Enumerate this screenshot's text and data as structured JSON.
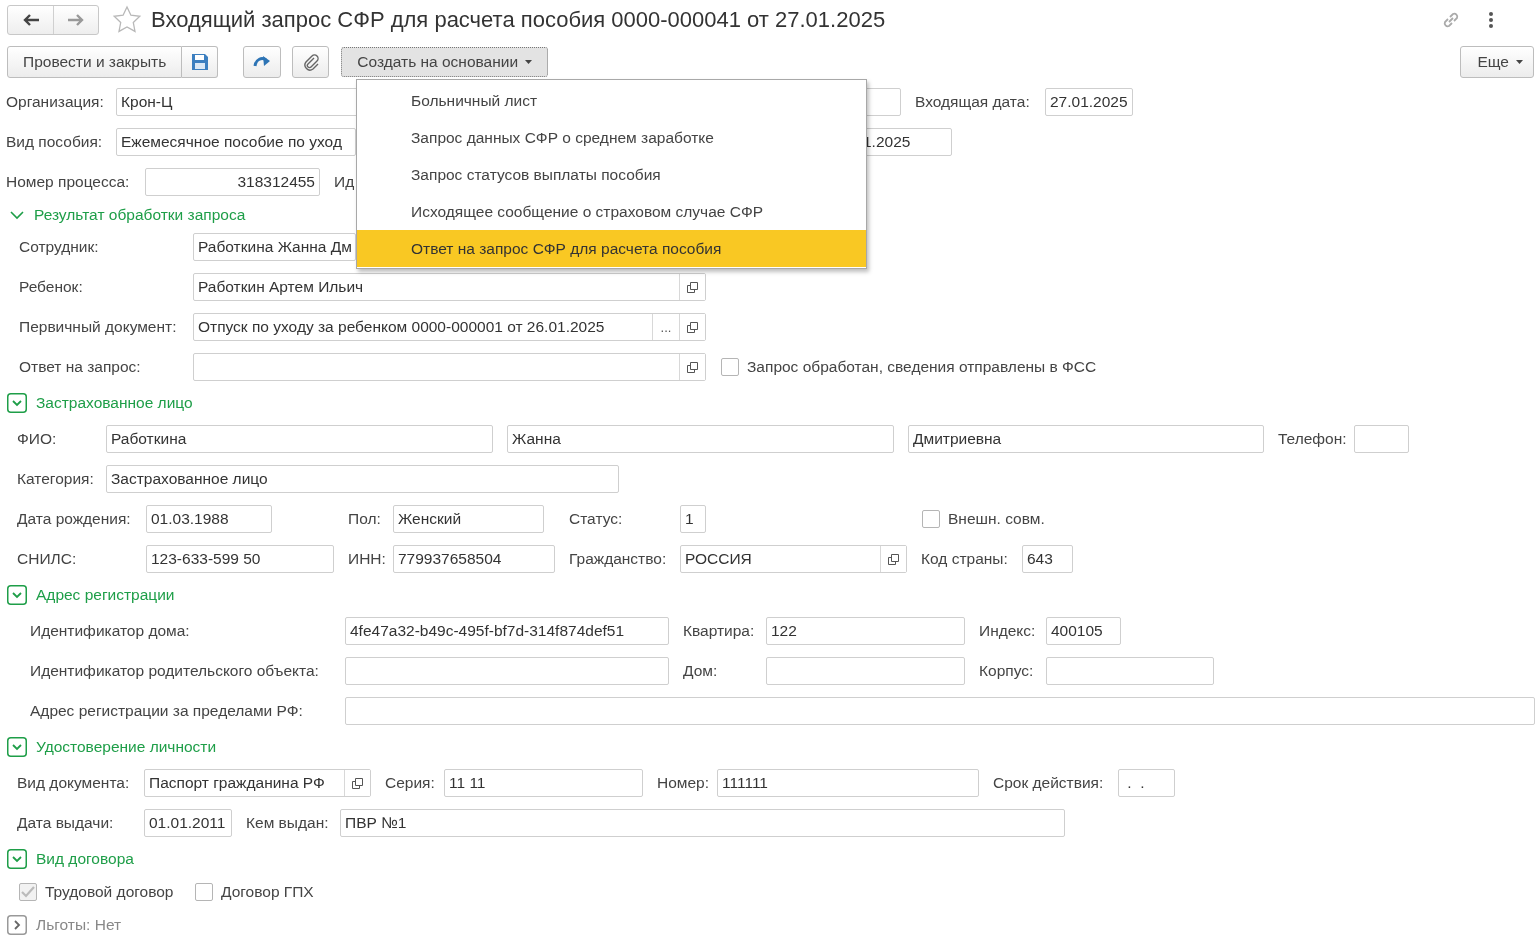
{
  "header": {
    "title": "Входящий запрос СФР для расчета пособия 0000-000041 от 27.01.2025",
    "favorite": false
  },
  "toolbar": {
    "post_close": "Провести и закрыть",
    "create_based": "Создать на основании",
    "more": "Еще"
  },
  "create_menu": {
    "open": true,
    "items": [
      {
        "label": "Больничный лист",
        "selected": false
      },
      {
        "label": "Запрос данных СФР о среднем заработке",
        "selected": false
      },
      {
        "label": "Запрос статусов выплаты пособия",
        "selected": false
      },
      {
        "label": "Исходящее сообщение о страховом случае СФР",
        "selected": false
      },
      {
        "label": "Ответ на запрос СФР для расчета пособия",
        "selected": true
      }
    ]
  },
  "top_rows": [
    {
      "items": [
        {
          "kind": "label",
          "text": "Организация:"
        },
        {
          "kind": "field",
          "value": "Крон-Ц"
        },
        {
          "kind": "label",
          "text": "Входящая дата:"
        },
        {
          "kind": "field",
          "value": "27.01.2025"
        }
      ]
    },
    {
      "items": [
        {
          "kind": "label",
          "text": "Вид пособия:"
        },
        {
          "kind": "field",
          "value": "Ежемесячное пособие по уход"
        },
        {
          "kind": "field",
          "value": "1.2025"
        }
      ]
    },
    {
      "items": [
        {
          "kind": "label",
          "text": "Номер процесса:"
        },
        {
          "kind": "field",
          "value": "318312455"
        },
        {
          "kind": "label",
          "text": "Ид"
        }
      ]
    }
  ],
  "sections": [
    {
      "title": "Результат обработки запроса",
      "kind": "plain",
      "expanded": true,
      "rows": [
        {
          "items": [
            {
              "kind": "label",
              "text": "Сотрудник:"
            },
            {
              "kind": "field",
              "value": "Работкина Жанна Дм"
            }
          ]
        },
        {
          "items": [
            {
              "kind": "label",
              "text": "Ребенок:"
            },
            {
              "kind": "field",
              "value": "Работкин Артем Ильич",
              "open_button": true
            }
          ]
        },
        {
          "items": [
            {
              "kind": "label",
              "text": "Первичный документ:"
            },
            {
              "kind": "field",
              "value": "Отпуск по уходу за ребенком 0000-000001 от 26.01.2025",
              "choose_label": "...",
              "open_button": true
            }
          ]
        },
        {
          "items": [
            {
              "kind": "label",
              "text": "Ответ на запрос:"
            },
            {
              "kind": "field",
              "value": "",
              "open_button": true
            },
            {
              "kind": "checkbox",
              "label": "Запрос обработан, сведения отправлены в ФСС",
              "checked": false,
              "disabled": false
            }
          ]
        }
      ]
    },
    {
      "title": "Застрахованное лицо",
      "kind": "boxed",
      "expanded": true,
      "rows": [
        {
          "items": [
            {
              "kind": "label",
              "text": "ФИО:"
            },
            {
              "kind": "field",
              "value": "Работкина"
            },
            {
              "kind": "field",
              "value": "Жанна"
            },
            {
              "kind": "field",
              "value": "Дмитриевна"
            },
            {
              "kind": "label",
              "text": "Телефон:"
            },
            {
              "kind": "field",
              "value": ""
            }
          ]
        },
        {
          "items": [
            {
              "kind": "label",
              "text": "Категория:"
            },
            {
              "kind": "field",
              "value": "Застрахованное лицо"
            }
          ]
        },
        {
          "items": [
            {
              "kind": "label",
              "text": "Дата рождения:"
            },
            {
              "kind": "field",
              "value": "01.03.1988"
            },
            {
              "kind": "label",
              "text": "Пол:"
            },
            {
              "kind": "field",
              "value": "Женский"
            },
            {
              "kind": "label",
              "text": "Статус:"
            },
            {
              "kind": "field",
              "value": "1"
            },
            {
              "kind": "checkbox",
              "label": "Внешн. совм.",
              "checked": false,
              "disabled": false
            }
          ]
        },
        {
          "items": [
            {
              "kind": "label",
              "text": "СНИЛС:"
            },
            {
              "kind": "field",
              "value": "123-633-599 50"
            },
            {
              "kind": "label",
              "text": "ИНН:"
            },
            {
              "kind": "field",
              "value": "779937658504"
            },
            {
              "kind": "label",
              "text": "Гражданство:"
            },
            {
              "kind": "field",
              "value": "РОССИЯ",
              "open_button": true
            },
            {
              "kind": "label",
              "text": "Код страны:"
            },
            {
              "kind": "field",
              "value": "643"
            }
          ]
        }
      ]
    },
    {
      "title": "Адрес регистрации",
      "kind": "boxed",
      "expanded": true,
      "rows": [
        {
          "items": [
            {
              "kind": "label",
              "text": "Идентификатор дома:"
            },
            {
              "kind": "field",
              "value": "4fe47a32-b49c-495f-bf7d-314f874def51"
            },
            {
              "kind": "label",
              "text": "Квартира:"
            },
            {
              "kind": "field",
              "value": "122"
            },
            {
              "kind": "label",
              "text": "Индекс:"
            },
            {
              "kind": "field",
              "value": "400105"
            }
          ]
        },
        {
          "items": [
            {
              "kind": "label",
              "text": "Идентификатор родительского объекта:"
            },
            {
              "kind": "field",
              "value": ""
            },
            {
              "kind": "label",
              "text": "Дом:"
            },
            {
              "kind": "field",
              "value": ""
            },
            {
              "kind": "label",
              "text": "Корпус:"
            },
            {
              "kind": "field",
              "value": ""
            }
          ]
        },
        {
          "items": [
            {
              "kind": "label",
              "text": "Адрес регистрации за пределами РФ:"
            },
            {
              "kind": "field",
              "value": ""
            }
          ]
        }
      ]
    },
    {
      "title": "Удостоверение личности",
      "kind": "boxed",
      "expanded": true,
      "rows": [
        {
          "items": [
            {
              "kind": "label",
              "text": "Вид документа:"
            },
            {
              "kind": "field",
              "value": "Паспорт гражданина РФ",
              "open_button": true
            },
            {
              "kind": "label",
              "text": "Серия:"
            },
            {
              "kind": "field",
              "value": "11 11"
            },
            {
              "kind": "label",
              "text": "Номер:"
            },
            {
              "kind": "field",
              "value": "111111"
            },
            {
              "kind": "label",
              "text": "Срок действия:"
            },
            {
              "kind": "field",
              "value": " .  ."
            }
          ]
        },
        {
          "items": [
            {
              "kind": "label",
              "text": "Дата выдачи:"
            },
            {
              "kind": "field",
              "value": "01.01.2011"
            },
            {
              "kind": "label",
              "text": "Кем выдан:"
            },
            {
              "kind": "field",
              "value": "ПВР №1"
            }
          ]
        }
      ]
    },
    {
      "title": "Вид договора",
      "kind": "boxed",
      "expanded": true,
      "rows": [
        {
          "items": [
            {
              "kind": "checkbox",
              "label": "Трудовой договор",
              "checked": true,
              "disabled": true
            },
            {
              "kind": "checkbox",
              "label": "Договор ГПХ",
              "checked": false,
              "disabled": false
            }
          ]
        }
      ]
    },
    {
      "title": "Льготы: Нет",
      "kind": "boxed",
      "expanded": false
    }
  ]
}
